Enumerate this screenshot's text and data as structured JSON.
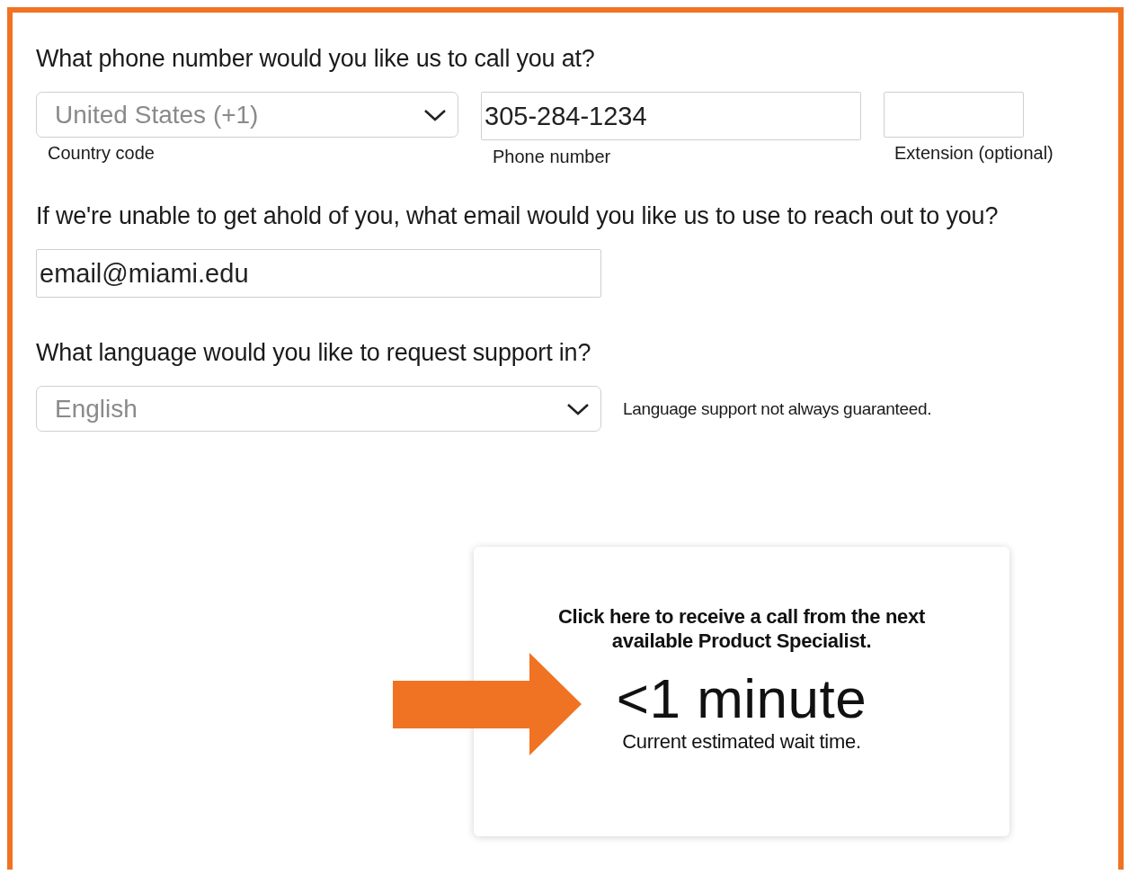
{
  "phone_section": {
    "prompt": "What phone number would you like us to call you at?",
    "country": {
      "value": "United States (+1)",
      "label": "Country code"
    },
    "phone": {
      "value": "305-284-1234",
      "label": "Phone number"
    },
    "extension": {
      "label": "Extension (optional)"
    }
  },
  "email_section": {
    "prompt": "If we're unable to get ahold of you, what email would you like us to use to reach out to you?",
    "value": "email@miami.edu"
  },
  "language_section": {
    "prompt": "What language would you like to request support in?",
    "value": "English",
    "note": "Language support not always guaranteed."
  },
  "callback_card": {
    "message": "Click here to receive a call from the next available Product Specialist.",
    "wait_time": "<1 minute",
    "wait_label": "Current estimated wait time."
  }
}
